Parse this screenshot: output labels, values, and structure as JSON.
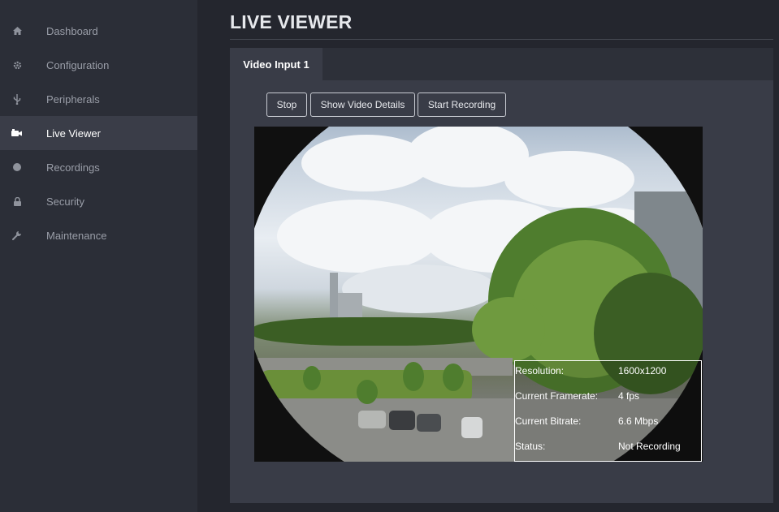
{
  "sidebar": {
    "items": [
      {
        "label": "Dashboard",
        "icon": "home-icon"
      },
      {
        "label": "Configuration",
        "icon": "gear-icon"
      },
      {
        "label": "Peripherals",
        "icon": "usb-icon"
      },
      {
        "label": "Live Viewer",
        "icon": "video-camera-icon",
        "active": true
      },
      {
        "label": "Recordings",
        "icon": "record-dot-icon"
      },
      {
        "label": "Security",
        "icon": "lock-icon"
      },
      {
        "label": "Maintenance",
        "icon": "wrench-icon"
      }
    ]
  },
  "main": {
    "title": "LIVE VIEWER",
    "tabs": [
      {
        "label": "Video Input 1",
        "active": true
      }
    ],
    "toolbar": {
      "stop_label": "Stop",
      "details_label": "Show Video Details",
      "record_label": "Start Recording"
    },
    "video_info": {
      "resolution_label": "Resolution:",
      "resolution_value": "1600x1200",
      "framerate_label": "Current Framerate:",
      "framerate_value": "4 fps",
      "bitrate_label": "Current Bitrate:",
      "bitrate_value": "6.6 Mbps",
      "status_label": "Status:",
      "status_value": "Not Recording"
    }
  },
  "colors": {
    "sidebar_bg": "#2b2e37",
    "active_item_bg": "#3a3d48",
    "panel_bg": "#393c47",
    "page_bg": "#24262e"
  }
}
